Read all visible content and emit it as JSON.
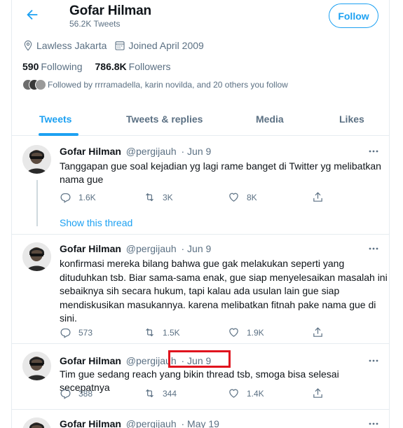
{
  "header": {
    "name": "Gofar Hilman",
    "tweet_count": "56.2K Tweets",
    "follow_label": "Follow"
  },
  "profile": {
    "location": "Lawless Jakarta",
    "joined": "Joined April 2009",
    "following_count": "590",
    "following_label": "Following",
    "followers_count": "786.8K",
    "followers_label": "Followers",
    "followed_by": "Followed by rrrramadella, karin novilda, and 20 others you follow"
  },
  "tabs": [
    "Tweets",
    "Tweets & replies",
    "Media",
    "Likes"
  ],
  "tweets": [
    {
      "name": "Gofar Hilman",
      "handle": "@pergijauh",
      "date": "· Jun 9",
      "text": "Tanggapan gue soal kejadian yg lagi rame banget di Twitter yg melibatkan nama gue",
      "replies": "1.6K",
      "retweets": "3K",
      "likes": "8K"
    },
    {
      "name": "Gofar Hilman",
      "handle": "@pergijauh",
      "date": "· Jun 9",
      "text": "konfirmasi mereka bilang bahwa gue gak melakukan seperti yang dituduhkan tsb. Biar sama-sama enak, gue siap menyelesaikan masalah ini sebaiknya sih secara hukum, tapi kalau ada usulan lain gue siap mendiskusikan masukannya. karena melibatkan fitnah pake nama gue di sini.",
      "replies": "573",
      "retweets": "1.5K",
      "likes": "1.9K"
    },
    {
      "name": "Gofar Hilman",
      "handle": "@pergijauh",
      "date": "· Jun 9",
      "text": "Tim gue sedang reach yang bikin thread tsb, smoga bisa selesai secepatnya",
      "replies": "388",
      "retweets": "344",
      "likes": "1.4K"
    },
    {
      "name": "Gofar Hilman",
      "handle": "@pergijauh",
      "date": "· May 19"
    }
  ],
  "show_thread": "Show this thread",
  "colors": {
    "accent": "#1da1f2",
    "highlight": "#e0141e"
  }
}
